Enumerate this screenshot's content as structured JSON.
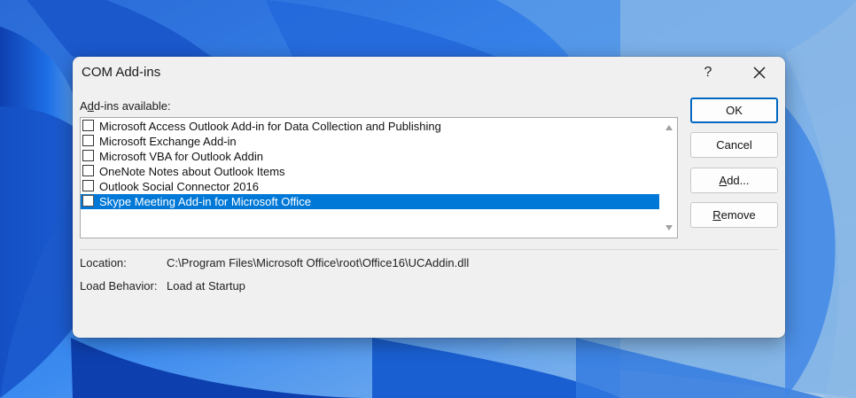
{
  "dialog": {
    "title": "COM Add-ins",
    "help_label": "?",
    "addins_label_pre": "A",
    "addins_label_ul": "d",
    "addins_label_post": "d-ins available:",
    "addins": [
      {
        "label": "Microsoft Access Outlook Add-in for Data Collection and Publishing",
        "checked": false
      },
      {
        "label": "Microsoft Exchange Add-in",
        "checked": false
      },
      {
        "label": "Microsoft VBA for Outlook Addin",
        "checked": false
      },
      {
        "label": "OneNote Notes about Outlook Items",
        "checked": false
      },
      {
        "label": "Outlook Social Connector 2016",
        "checked": false
      },
      {
        "label": "Skype Meeting Add-in for Microsoft Office",
        "checked": false,
        "selected": true
      }
    ],
    "buttons": {
      "ok": "OK",
      "cancel": "Cancel",
      "add_ul": "A",
      "add_rest": "dd...",
      "remove_ul": "R",
      "remove_rest": "emove"
    },
    "location_label": "Location:",
    "location_value": "C:\\Program Files\\Microsoft Office\\root\\Office16\\UCAddin.dll",
    "load_behavior_label": "Load Behavior:",
    "load_behavior_value": "Load at Startup"
  },
  "colors": {
    "selection": "#0078d7",
    "default_button_border": "#0067c0",
    "dialog_background": "#f0f0f0",
    "wallpaper_blue": "#1a5fd1"
  }
}
